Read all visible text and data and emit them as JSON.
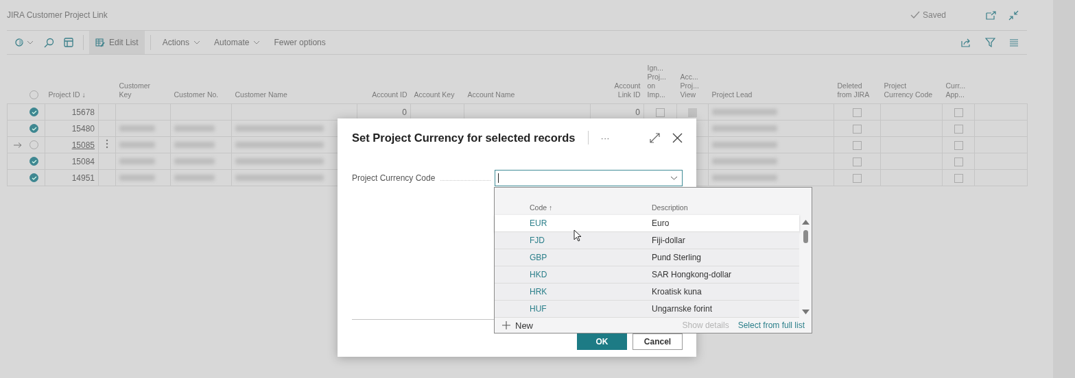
{
  "page": {
    "title": "JIRA Customer Project Link",
    "status": "Saved"
  },
  "toolbar": {
    "items": [
      {
        "label": "Edit List",
        "active": true,
        "has_menu": false
      },
      {
        "label": "Actions",
        "active": false,
        "has_menu": true
      },
      {
        "label": "Automate",
        "active": false,
        "has_menu": true
      },
      {
        "label": "Fewer options",
        "active": false,
        "has_menu": false
      }
    ]
  },
  "table": {
    "select_all": {
      "checked": false
    },
    "columns": [
      "Project ID ↓",
      "Customer\nKey",
      "Customer No.",
      "Customer Name",
      "Account ID",
      "Account Key",
      "Account Name",
      "Account\nLink ID",
      "Ign...\nProj...\non\nImp...",
      "Acc...\nProj...\nView",
      "Project Lead",
      "Deleted\nfrom JIRA",
      "Project\nCurrency Code",
      "Curr...\nApp..."
    ],
    "rows": [
      {
        "selected": true,
        "current": false,
        "project_id": "15678",
        "customer_redacted": false,
        "account_id": "0",
        "account_link_id": "0",
        "ignore_on_import": {
          "checked": false,
          "disabled": false
        },
        "access_view": {
          "checked": false,
          "disabled": true
        },
        "lead_redacted": true,
        "deleted": false,
        "currency_applied": false
      },
      {
        "selected": true,
        "current": false,
        "project_id": "15480",
        "customer_redacted": true,
        "lead_redacted": true,
        "deleted": false,
        "currency_applied": false
      },
      {
        "selected": false,
        "current": true,
        "project_id": "15085",
        "customer_redacted": true,
        "lead_redacted": true,
        "deleted": false,
        "currency_applied": false
      },
      {
        "selected": true,
        "current": false,
        "project_id": "15084",
        "customer_redacted": true,
        "lead_redacted": true,
        "deleted": false,
        "currency_applied": false
      },
      {
        "selected": true,
        "current": false,
        "project_id": "14951",
        "customer_redacted": true,
        "lead_redacted": true,
        "deleted": false,
        "currency_applied": false
      }
    ]
  },
  "dialog": {
    "title": "Set Project Currency for selected records",
    "more": "···",
    "field": {
      "label": "Project Currency Code"
    },
    "dropdown": {
      "columns": [
        "Code ↑",
        "Description"
      ],
      "rows": [
        {
          "code": "EUR",
          "description": "Euro",
          "selected": true
        },
        {
          "code": "FJD",
          "description": "Fiji-dollar",
          "selected": false
        },
        {
          "code": "GBP",
          "description": "Pund Sterling",
          "selected": false
        },
        {
          "code": "HKD",
          "description": "SAR Hongkong-dollar",
          "selected": false
        },
        {
          "code": "HRK",
          "description": "Kroatisk kuna",
          "selected": false
        },
        {
          "code": "HUF",
          "description": "Ungarnske forint",
          "selected": false
        }
      ],
      "actions": [
        {
          "label": "New",
          "kind": "new",
          "disabled": false
        },
        {
          "label": "Show details",
          "kind": "link",
          "disabled": true
        },
        {
          "label": "Select from full list",
          "kind": "link",
          "disabled": false
        }
      ]
    },
    "buttons": [
      {
        "label": "OK",
        "kind": "primary"
      },
      {
        "label": "Cancel",
        "kind": "secondary"
      }
    ]
  }
}
